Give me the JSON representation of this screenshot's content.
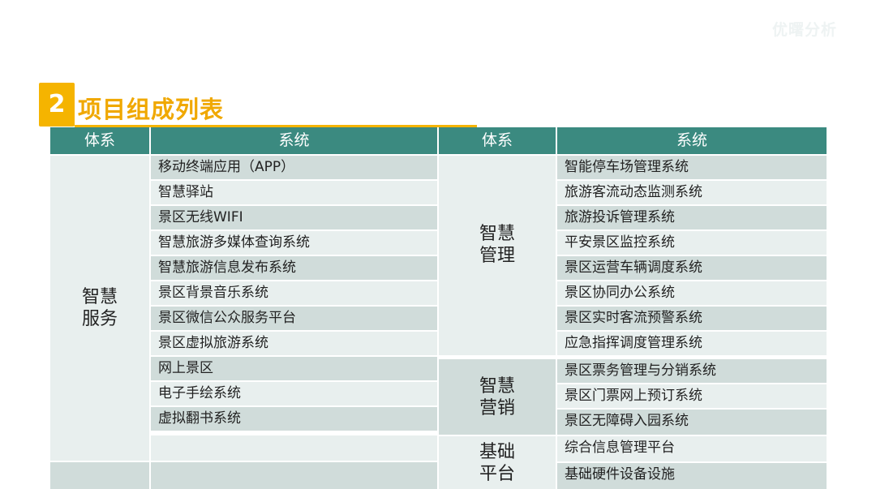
{
  "watermark": "优曙分析",
  "section": {
    "number": "2",
    "title": "项目组成列表"
  },
  "table": {
    "headers": {
      "category": "体系",
      "system": "系统"
    },
    "left_group": {
      "line1": "智慧",
      "line2": "服务"
    },
    "left_rows": [
      "移动终端应用（APP）",
      "智慧驿站",
      "景区无线WIFI",
      "智慧旅游多媒体查询系统",
      "智慧旅游信息发布系统",
      "景区背景音乐系统",
      "景区微信公众服务平台",
      "景区虚拟旅游系统",
      "网上景区",
      "电子手绘系统",
      "虚拟翻书系统",
      "",
      ""
    ],
    "right_groups": [
      {
        "line1": "智慧",
        "line2": "管理"
      },
      {
        "line1": "智慧",
        "line2": "营销"
      },
      {
        "line1": "基础",
        "line2": "平台"
      }
    ],
    "right_rows": [
      "智能停车场管理系统",
      "旅游客流动态监测系统",
      "旅游投诉管理系统",
      "平安景区监控系统",
      "景区运营车辆调度系统",
      "景区协同办公系统",
      "景区实时客流预警系统",
      "应急指挥调度管理系统",
      "景区票务管理与分销系统",
      "景区门票网上预订系统",
      "景区无障碍入园系统",
      "综合信息管理平台",
      "基础硬件设备设施"
    ]
  }
}
